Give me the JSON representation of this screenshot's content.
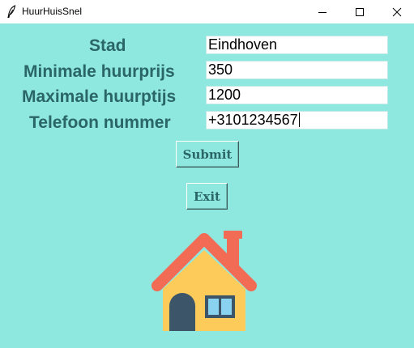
{
  "window": {
    "title": "HuurHuisSnel",
    "icon": "feather-icon",
    "controls": [
      "minimize-icon",
      "maximize-icon",
      "close-icon"
    ]
  },
  "form": {
    "fields": [
      {
        "label": "Stad",
        "value": "Eindhoven"
      },
      {
        "label": "Minimale huurprijs",
        "value": "350"
      },
      {
        "label": "Maximale huurptijs",
        "value": "1200"
      },
      {
        "label": "Telefoon nummer",
        "value": "+3101234567"
      }
    ],
    "submit_label": "Submit",
    "exit_label": "Exit"
  },
  "image": {
    "icon": "house-icon"
  },
  "colors": {
    "background": "#8fe8df",
    "label_text": "#2a6568",
    "roof": "#f26b55",
    "house_wall": "#fccb5a",
    "door": "#3d5569",
    "window": "#8ad3f0"
  }
}
